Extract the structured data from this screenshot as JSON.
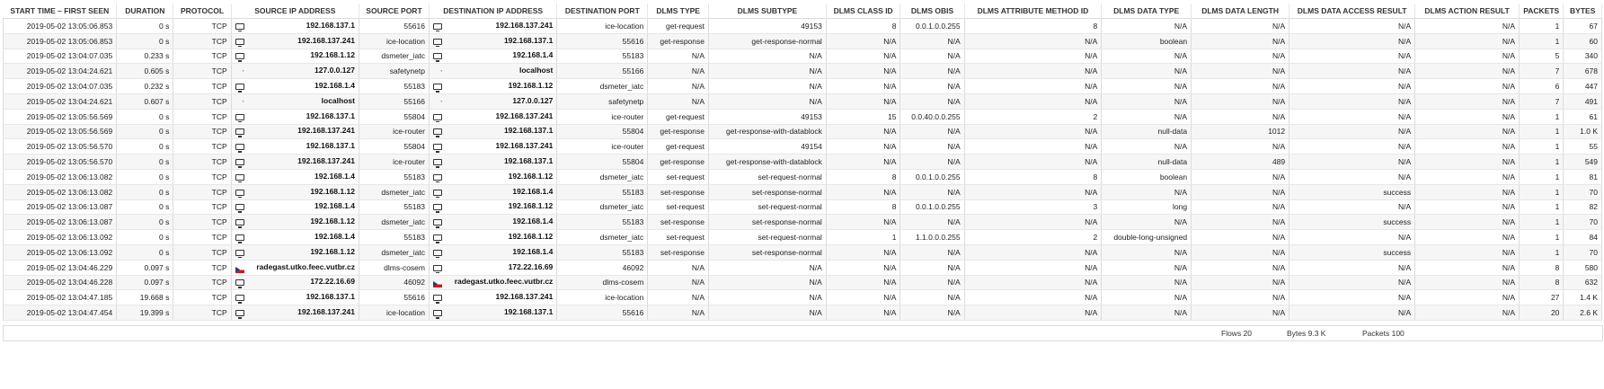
{
  "columns": [
    {
      "key": "start",
      "label": "START TIME – FIRST SEEN",
      "width": 110
    },
    {
      "key": "duration",
      "label": "DURATION",
      "width": 55
    },
    {
      "key": "protocol",
      "label": "PROTOCOL",
      "width": 56
    },
    {
      "key": "src_ip",
      "label": "SOURCE IP ADDRESS",
      "width": 124
    },
    {
      "key": "src_port",
      "label": "SOURCE PORT",
      "width": 68
    },
    {
      "key": "dst_ip",
      "label": "DESTINATION IP ADDRESS",
      "width": 124
    },
    {
      "key": "dst_port",
      "label": "DESTINATION PORT",
      "width": 88
    },
    {
      "key": "dlms_type",
      "label": "DLMS TYPE",
      "width": 59
    },
    {
      "key": "dlms_subtype",
      "label": "DLMS SUBTYPE",
      "width": 114
    },
    {
      "key": "class_id",
      "label": "DLMS CLASS ID",
      "width": 72
    },
    {
      "key": "obis",
      "label": "DLMS OBIS",
      "width": 62
    },
    {
      "key": "attr",
      "label": "DLMS ATTRIBUTE METHOD ID",
      "width": 133
    },
    {
      "key": "data_type",
      "label": "DLMS DATA TYPE",
      "width": 87
    },
    {
      "key": "data_length",
      "label": "DLMS DATA LENGTH",
      "width": 95
    },
    {
      "key": "access_result",
      "label": "DLMS DATA ACCESS RESULT",
      "width": 122
    },
    {
      "key": "action_result",
      "label": "DLMS ACTION RESULT",
      "width": 101
    },
    {
      "key": "packets",
      "label": "PACKETS",
      "width": 43
    },
    {
      "key": "bytes",
      "label": "BYTES",
      "width": 37
    }
  ],
  "rows": [
    {
      "start": "2019-05-02 13:05:06.853",
      "duration": "0 s",
      "protocol": "TCP",
      "src_icon": "computer-icon",
      "src_ip": "192.168.137.1",
      "src_port": "55616",
      "dst_icon": "computer-icon",
      "dst_ip": "192.168.137.241",
      "dst_port": "ice-location",
      "dlms_type": "get-request",
      "dlms_subtype": "49153",
      "class_id": "8",
      "obis": "0.0.1.0.0.255",
      "attr": "8",
      "data_type": "N/A",
      "data_length": "N/A",
      "access_result": "N/A",
      "action_result": "N/A",
      "packets": "1",
      "bytes": "67"
    },
    {
      "start": "2019-05-02 13:05:06.853",
      "duration": "0 s",
      "protocol": "TCP",
      "src_icon": "computer-icon",
      "src_ip": "192.168.137.241",
      "src_port": "ice-location",
      "dst_icon": "computer-icon",
      "dst_ip": "192.168.137.1",
      "dst_port": "55616",
      "dlms_type": "get-response",
      "dlms_subtype": "get-response-normal",
      "class_id": "N/A",
      "obis": "N/A",
      "attr": "N/A",
      "data_type": "boolean",
      "data_length": "N/A",
      "access_result": "N/A",
      "action_result": "N/A",
      "packets": "1",
      "bytes": "60"
    },
    {
      "start": "2019-05-02 13:04:07.035",
      "duration": "0.233 s",
      "protocol": "TCP",
      "src_icon": "computer-icon",
      "src_ip": "192.168.1.12",
      "src_port": "dsmeter_iatc",
      "dst_icon": "computer-icon",
      "dst_ip": "192.168.1.4",
      "dst_port": "55183",
      "dlms_type": "N/A",
      "dlms_subtype": "N/A",
      "class_id": "N/A",
      "obis": "N/A",
      "attr": "N/A",
      "data_type": "N/A",
      "data_length": "N/A",
      "access_result": "N/A",
      "action_result": "N/A",
      "packets": "5",
      "bytes": "340"
    },
    {
      "start": "2019-05-02 13:04:24.621",
      "duration": "0.605 s",
      "protocol": "TCP",
      "src_icon": "unknown-icon",
      "src_ip": "127.0.0.127",
      "src_port": "safetynetp",
      "dst_icon": "unknown-icon",
      "dst_ip": "localhost",
      "dst_port": "55166",
      "dlms_type": "N/A",
      "dlms_subtype": "N/A",
      "class_id": "N/A",
      "obis": "N/A",
      "attr": "N/A",
      "data_type": "N/A",
      "data_length": "N/A",
      "access_result": "N/A",
      "action_result": "N/A",
      "packets": "7",
      "bytes": "678"
    },
    {
      "start": "2019-05-02 13:04:07.035",
      "duration": "0.232 s",
      "protocol": "TCP",
      "src_icon": "computer-icon",
      "src_ip": "192.168.1.4",
      "src_port": "55183",
      "dst_icon": "computer-icon",
      "dst_ip": "192.168.1.12",
      "dst_port": "dsmeter_iatc",
      "dlms_type": "N/A",
      "dlms_subtype": "N/A",
      "class_id": "N/A",
      "obis": "N/A",
      "attr": "N/A",
      "data_type": "N/A",
      "data_length": "N/A",
      "access_result": "N/A",
      "action_result": "N/A",
      "packets": "6",
      "bytes": "447"
    },
    {
      "start": "2019-05-02 13:04:24.621",
      "duration": "0.607 s",
      "protocol": "TCP",
      "src_icon": "unknown-icon",
      "src_ip": "localhost",
      "src_port": "55166",
      "dst_icon": "unknown-icon",
      "dst_ip": "127.0.0.127",
      "dst_port": "safetynetp",
      "dlms_type": "N/A",
      "dlms_subtype": "N/A",
      "class_id": "N/A",
      "obis": "N/A",
      "attr": "N/A",
      "data_type": "N/A",
      "data_length": "N/A",
      "access_result": "N/A",
      "action_result": "N/A",
      "packets": "7",
      "bytes": "491"
    },
    {
      "start": "2019-05-02 13:05:56.569",
      "duration": "0 s",
      "protocol": "TCP",
      "src_icon": "computer-icon",
      "src_ip": "192.168.137.1",
      "src_port": "55804",
      "dst_icon": "computer-icon",
      "dst_ip": "192.168.137.241",
      "dst_port": "ice-router",
      "dlms_type": "get-request",
      "dlms_subtype": "49153",
      "class_id": "15",
      "obis": "0.0.40.0.0.255",
      "attr": "2",
      "data_type": "N/A",
      "data_length": "N/A",
      "access_result": "N/A",
      "action_result": "N/A",
      "packets": "1",
      "bytes": "61"
    },
    {
      "start": "2019-05-02 13:05:56.569",
      "duration": "0 s",
      "protocol": "TCP",
      "src_icon": "computer-icon",
      "src_ip": "192.168.137.241",
      "src_port": "ice-router",
      "dst_icon": "computer-icon",
      "dst_ip": "192.168.137.1",
      "dst_port": "55804",
      "dlms_type": "get-response",
      "dlms_subtype": "get-response-with-datablock",
      "class_id": "N/A",
      "obis": "N/A",
      "attr": "N/A",
      "data_type": "null-data",
      "data_length": "1012",
      "access_result": "N/A",
      "action_result": "N/A",
      "packets": "1",
      "bytes": "1.0 K"
    },
    {
      "start": "2019-05-02 13:05:56.570",
      "duration": "0 s",
      "protocol": "TCP",
      "src_icon": "computer-icon",
      "src_ip": "192.168.137.1",
      "src_port": "55804",
      "dst_icon": "computer-icon",
      "dst_ip": "192.168.137.241",
      "dst_port": "ice-router",
      "dlms_type": "get-request",
      "dlms_subtype": "49154",
      "class_id": "N/A",
      "obis": "N/A",
      "attr": "N/A",
      "data_type": "N/A",
      "data_length": "N/A",
      "access_result": "N/A",
      "action_result": "N/A",
      "packets": "1",
      "bytes": "55"
    },
    {
      "start": "2019-05-02 13:05:56.570",
      "duration": "0 s",
      "protocol": "TCP",
      "src_icon": "computer-icon",
      "src_ip": "192.168.137.241",
      "src_port": "ice-router",
      "dst_icon": "computer-icon",
      "dst_ip": "192.168.137.1",
      "dst_port": "55804",
      "dlms_type": "get-response",
      "dlms_subtype": "get-response-with-datablock",
      "class_id": "N/A",
      "obis": "N/A",
      "attr": "N/A",
      "data_type": "null-data",
      "data_length": "489",
      "access_result": "N/A",
      "action_result": "N/A",
      "packets": "1",
      "bytes": "549"
    },
    {
      "start": "2019-05-02 13:06:13.082",
      "duration": "0 s",
      "protocol": "TCP",
      "src_icon": "computer-icon",
      "src_ip": "192.168.1.4",
      "src_port": "55183",
      "dst_icon": "computer-icon",
      "dst_ip": "192.168.1.12",
      "dst_port": "dsmeter_iatc",
      "dlms_type": "set-request",
      "dlms_subtype": "set-request-normal",
      "class_id": "8",
      "obis": "0.0.1.0.0.255",
      "attr": "8",
      "data_type": "boolean",
      "data_length": "N/A",
      "access_result": "N/A",
      "action_result": "N/A",
      "packets": "1",
      "bytes": "81"
    },
    {
      "start": "2019-05-02 13:06:13.082",
      "duration": "0 s",
      "protocol": "TCP",
      "src_icon": "computer-icon",
      "src_ip": "192.168.1.12",
      "src_port": "dsmeter_iatc",
      "dst_icon": "computer-icon",
      "dst_ip": "192.168.1.4",
      "dst_port": "55183",
      "dlms_type": "set-response",
      "dlms_subtype": "set-response-normal",
      "class_id": "N/A",
      "obis": "N/A",
      "attr": "N/A",
      "data_type": "N/A",
      "data_length": "N/A",
      "access_result": "success",
      "action_result": "N/A",
      "packets": "1",
      "bytes": "70"
    },
    {
      "start": "2019-05-02 13:06:13.087",
      "duration": "0 s",
      "protocol": "TCP",
      "src_icon": "computer-icon",
      "src_ip": "192.168.1.4",
      "src_port": "55183",
      "dst_icon": "computer-icon",
      "dst_ip": "192.168.1.12",
      "dst_port": "dsmeter_iatc",
      "dlms_type": "set-request",
      "dlms_subtype": "set-request-normal",
      "class_id": "8",
      "obis": "0.0.1.0.0.255",
      "attr": "3",
      "data_type": "long",
      "data_length": "N/A",
      "access_result": "N/A",
      "action_result": "N/A",
      "packets": "1",
      "bytes": "82"
    },
    {
      "start": "2019-05-02 13:06:13.087",
      "duration": "0 s",
      "protocol": "TCP",
      "src_icon": "computer-icon",
      "src_ip": "192.168.1.12",
      "src_port": "dsmeter_iatc",
      "dst_icon": "computer-icon",
      "dst_ip": "192.168.1.4",
      "dst_port": "55183",
      "dlms_type": "set-response",
      "dlms_subtype": "set-response-normal",
      "class_id": "N/A",
      "obis": "N/A",
      "attr": "N/A",
      "data_type": "N/A",
      "data_length": "N/A",
      "access_result": "success",
      "action_result": "N/A",
      "packets": "1",
      "bytes": "70"
    },
    {
      "start": "2019-05-02 13:06:13.092",
      "duration": "0 s",
      "protocol": "TCP",
      "src_icon": "computer-icon",
      "src_ip": "192.168.1.4",
      "src_port": "55183",
      "dst_icon": "computer-icon",
      "dst_ip": "192.168.1.12",
      "dst_port": "dsmeter_iatc",
      "dlms_type": "set-request",
      "dlms_subtype": "set-request-normal",
      "class_id": "1",
      "obis": "1.1.0.0.0.255",
      "attr": "2",
      "data_type": "double-long-unsigned",
      "data_length": "N/A",
      "access_result": "N/A",
      "action_result": "N/A",
      "packets": "1",
      "bytes": "84"
    },
    {
      "start": "2019-05-02 13:06:13.092",
      "duration": "0 s",
      "protocol": "TCP",
      "src_icon": "computer-icon",
      "src_ip": "192.168.1.12",
      "src_port": "dsmeter_iatc",
      "dst_icon": "computer-icon",
      "dst_ip": "192.168.1.4",
      "dst_port": "55183",
      "dlms_type": "set-response",
      "dlms_subtype": "set-response-normal",
      "class_id": "N/A",
      "obis": "N/A",
      "attr": "N/A",
      "data_type": "N/A",
      "data_length": "N/A",
      "access_result": "success",
      "action_result": "N/A",
      "packets": "1",
      "bytes": "70"
    },
    {
      "start": "2019-05-02 13:04:46.229",
      "duration": "0.097 s",
      "protocol": "TCP",
      "src_icon": "czech-flag-icon",
      "src_ip": "radegast.utko.feec.vutbr.cz",
      "src_port": "dlms-cosem",
      "dst_icon": "computer-icon",
      "dst_ip": "172.22.16.69",
      "dst_port": "46092",
      "dlms_type": "N/A",
      "dlms_subtype": "N/A",
      "class_id": "N/A",
      "obis": "N/A",
      "attr": "N/A",
      "data_type": "N/A",
      "data_length": "N/A",
      "access_result": "N/A",
      "action_result": "N/A",
      "packets": "8",
      "bytes": "580"
    },
    {
      "start": "2019-05-02 13:04:46.228",
      "duration": "0.097 s",
      "protocol": "TCP",
      "src_icon": "computer-icon",
      "src_ip": "172.22.16.69",
      "src_port": "46092",
      "dst_icon": "czech-flag-icon",
      "dst_ip": "radegast.utko.feec.vutbr.cz",
      "dst_port": "dlms-cosem",
      "dlms_type": "N/A",
      "dlms_subtype": "N/A",
      "class_id": "N/A",
      "obis": "N/A",
      "attr": "N/A",
      "data_type": "N/A",
      "data_length": "N/A",
      "access_result": "N/A",
      "action_result": "N/A",
      "packets": "8",
      "bytes": "632"
    },
    {
      "start": "2019-05-02 13:04:47.185",
      "duration": "19.668 s",
      "protocol": "TCP",
      "src_icon": "computer-icon",
      "src_ip": "192.168.137.1",
      "src_port": "55616",
      "dst_icon": "computer-icon",
      "dst_ip": "192.168.137.241",
      "dst_port": "ice-location",
      "dlms_type": "N/A",
      "dlms_subtype": "N/A",
      "class_id": "N/A",
      "obis": "N/A",
      "attr": "N/A",
      "data_type": "N/A",
      "data_length": "N/A",
      "access_result": "N/A",
      "action_result": "N/A",
      "packets": "27",
      "bytes": "1.4 K"
    },
    {
      "start": "2019-05-02 13:04:47.454",
      "duration": "19.399 s",
      "protocol": "TCP",
      "src_icon": "computer-icon",
      "src_ip": "192.168.137.241",
      "src_port": "ice-location",
      "dst_icon": "computer-icon",
      "dst_ip": "192.168.137.1",
      "dst_port": "55616",
      "dlms_type": "N/A",
      "dlms_subtype": "N/A",
      "class_id": "N/A",
      "obis": "N/A",
      "attr": "N/A",
      "data_type": "N/A",
      "data_length": "N/A",
      "access_result": "N/A",
      "action_result": "N/A",
      "packets": "20",
      "bytes": "2.6 K"
    }
  ],
  "footer": {
    "flows": "Flows 20",
    "bytes": "Bytes 9.3 K",
    "packets": "Packets 100"
  }
}
